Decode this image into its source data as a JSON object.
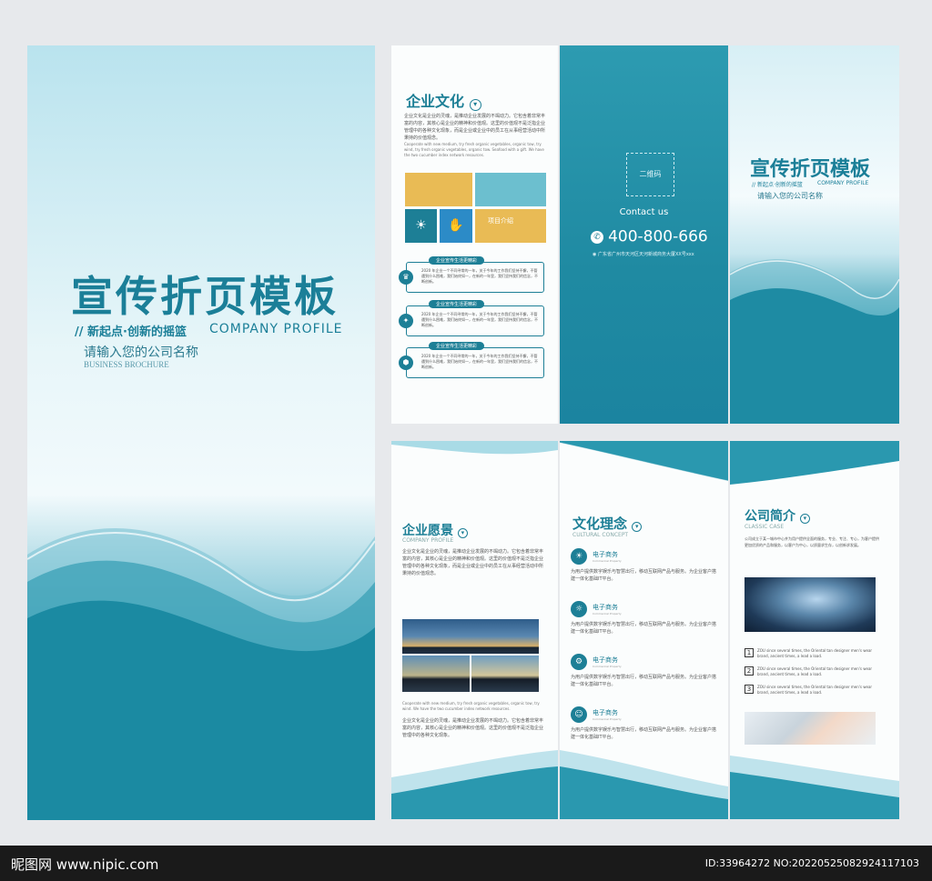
{
  "cover": {
    "title": "宣传折页模板",
    "slogan": "// 新起点·创新的摇篮",
    "subtitle": "COMPANY PROFILE",
    "company": "请输入您的公司名称",
    "brochure": "BUSINESS BROCHURE"
  },
  "culture": {
    "title": "企业文化",
    "para": "企业文化是企业的灵魂，是推动企业发展的不竭动力。它包含着非常丰富的内容，其核心是企业的精神和价值观。这里的价值观不是泛指企业管理中的各种文化现象，而是企业或企业中的员工在从事经营活动中所秉持的价值观念。",
    "en": "Cooperate with new medium, try fresh organic vegetables, organic tow, try wind, try fresh organic vegetables, organic tow. Seafood with a gift. We have the two cucumber index network resources.",
    "intro_label": "项目介绍",
    "items": [
      {
        "heading": "企业宣传生活更精彩",
        "text": "2020 年企业一个不同寻常的一年，关于今年的工作我们坚持不懈，不管遇到什么困难，我们始终如一，在新的一年里，我们坚持我们的信念，不断创新。"
      },
      {
        "heading": "企业宣传生活更精彩",
        "text": "2020 年企业一个不同寻常的一年，关于今年的工作我们坚持不懈，不管遇到什么困难，我们始终如一，在新的一年里，我们坚持我们的信念，不断创新。"
      },
      {
        "heading": "企业宣传生活更精彩",
        "text": "2020 年企业一个不同寻常的一年，关于今年的工作我们坚持不懈，不管遇到什么困难，我们始终如一，在新的一年里，我们坚持我们的信念，不断创新。"
      }
    ]
  },
  "contact": {
    "qr": "二维码",
    "label": "Contact us",
    "phone": "400-800-666",
    "address": "广东省广州市天河区天河新城商务大厦XX号xxx"
  },
  "fold": {
    "title": "宣传折页模板",
    "subtitle": "// 新起点·创新的摇篮",
    "en": "COMPANY PROFILE",
    "company": "请输入您的公司名称"
  },
  "vision": {
    "title": "企业愿景",
    "en": "COMPANY PROFILE",
    "para": "企业文化是企业的灵魂，是推动企业发展的不竭动力。它包含着非常丰富的内容，其核心是企业的精神和价值观。这里的价值观不是泛指企业管理中的各种文化现象，而是企业或企业中的员工在从事经营活动中所秉持的价值观念。",
    "caption": "Cooperate with new medium, try fresh organic vegetables, organic tow, try wind. We have the two cucumber index network resources.",
    "para2": "企业文化是企业的灵魂，是推动企业发展的不竭动力。它包含着非常丰富的内容，其核心是企业的精神和价值观。这里的价值观不是泛指企业管理中的各种文化现象。"
  },
  "concept": {
    "title": "文化理念",
    "en": "CULTURAL CONCEPT",
    "items": [
      {
        "name": "电子商务",
        "en": "Commercial Property",
        "text": "为用户提供数字娱乐与智慧出行，移动互联网产品与服务。为企业客户搭建一体化基础IT平台。"
      },
      {
        "name": "电子商务",
        "en": "Commercial Property",
        "text": "为用户提供数字娱乐与智慧出行，移动互联网产品与服务。为企业客户搭建一体化基础IT平台。"
      },
      {
        "name": "电子商务",
        "en": "Commercial Property",
        "text": "为用户提供数字娱乐与智慧出行，移动互联网产品与服务。为企业客户搭建一体化基础IT平台。"
      },
      {
        "name": "电子商务",
        "en": "Commercial Property",
        "text": "为用户提供数字娱乐与智慧出行，移动互联网产品与服务。为企业客户搭建一体化基础IT平台。"
      }
    ]
  },
  "profile": {
    "title": "公司简介",
    "en": "CLASSIC CASE",
    "para": "公司成立于某一城市中心并为用户提供全面的服务，专业、专注、专心，为客户提供更加优质的产品和服务，以客户为中心，以质量求生存，以创新求发展。",
    "items": [
      {
        "num": "1",
        "text": "ZOU since several times, the Oriental tan designer men's wear brand, ancient times, a lead a load."
      },
      {
        "num": "2",
        "text": "ZOU since several times, the Oriental tan designer men's wear brand, ancient times, a lead a load."
      },
      {
        "num": "3",
        "text": "ZOU since several times, the Oriental tan designer men's wear brand, ancient times, a lead a load."
      }
    ]
  },
  "watermark": {
    "logo": "昵图网 www.nipic.com",
    "id": "ID:33964272 NO:20220525082924117103"
  }
}
